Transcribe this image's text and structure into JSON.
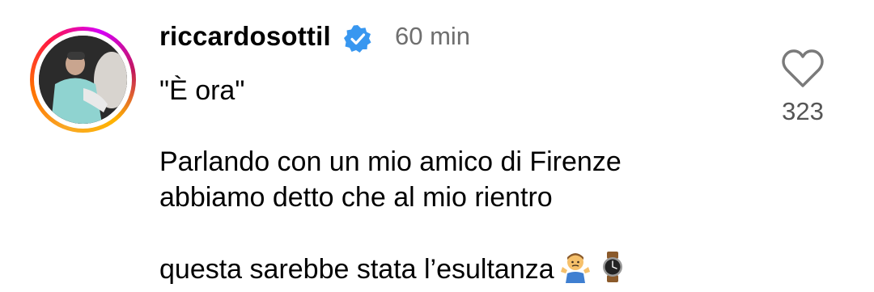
{
  "comment": {
    "username": "riccardosottil",
    "time": "60 min",
    "text_line1": "\"È ora\"",
    "text_line2": "",
    "text_line3": "",
    "text_para1": "Parlando con un mio amico di Firenze",
    "text_para2": "abbiamo detto che al mio rientro",
    "text_para3": "questa sarebbe stata l’esultanza",
    "likes": "323",
    "icons": {
      "verified": "verified-badge-icon",
      "like": "heart-outline-icon",
      "emoji1": "person-shrugging-emoji",
      "emoji2": "watch-emoji"
    },
    "colors": {
      "verified": "#3897f0",
      "muted": "#6f6f6f"
    }
  }
}
